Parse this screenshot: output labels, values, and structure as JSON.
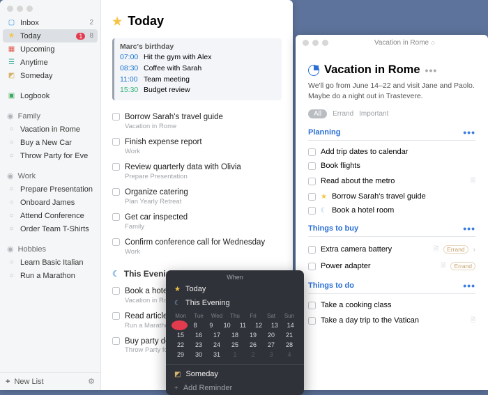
{
  "sidebar": {
    "inbox": {
      "label": "Inbox",
      "count": "2"
    },
    "today": {
      "label": "Today",
      "badge": "1",
      "count": "8"
    },
    "upcoming": {
      "label": "Upcoming"
    },
    "anytime": {
      "label": "Anytime"
    },
    "someday": {
      "label": "Someday"
    },
    "logbook": {
      "label": "Logbook"
    },
    "areas": [
      {
        "label": "Family",
        "items": [
          "Vacation in Rome",
          "Buy a New Car",
          "Throw Party for Eve"
        ]
      },
      {
        "label": "Work",
        "items": [
          "Prepare Presentation",
          "Onboard James",
          "Attend Conference",
          "Order Team T-Shirts"
        ]
      },
      {
        "label": "Hobbies",
        "items": [
          "Learn Basic Italian",
          "Run a Marathon"
        ]
      }
    ],
    "footer": {
      "new_list": "New List"
    }
  },
  "today": {
    "title": "Today",
    "schedule": {
      "heading": "Marc's birthday",
      "rows": [
        {
          "time": "07:00",
          "text": "Hit the gym with Alex"
        },
        {
          "time": "08:30",
          "text": "Coffee with Sarah"
        },
        {
          "time": "11:00",
          "text": "Team meeting"
        },
        {
          "time": "15:30",
          "text": "Budget review",
          "green": true
        }
      ]
    },
    "tasks": [
      {
        "title": "Borrow Sarah's travel guide",
        "sub": "Vacation in Rome"
      },
      {
        "title": "Finish expense report",
        "sub": "Work"
      },
      {
        "title": "Review quarterly data with Olivia",
        "sub": "Prepare Presentation"
      },
      {
        "title": "Organize catering",
        "sub": "Plan Yearly Retreat"
      },
      {
        "title": "Get car inspected",
        "sub": "Family"
      },
      {
        "title": "Confirm conference call for Wednesday",
        "sub": "Work"
      }
    ],
    "evening": {
      "title": "This Evening",
      "tasks": [
        {
          "title": "Book a hotel room",
          "sub": "Vacation in Rome"
        },
        {
          "title": "Read article about",
          "sub": "Run a Marathon"
        },
        {
          "title": "Buy party decoration",
          "sub": "Throw Party for Eve"
        }
      ]
    }
  },
  "popover": {
    "title": "When",
    "today": "Today",
    "evening": "This Evening",
    "days": [
      "Mon",
      "Tue",
      "Wed",
      "Thu",
      "Fri",
      "Sat",
      "Sun"
    ],
    "weeks": [
      [
        "",
        "",
        "8",
        "9",
        "10",
        "11",
        "12",
        "13",
        "14"
      ],
      [
        "",
        "15",
        "16",
        "17",
        "18",
        "19",
        "20",
        "21"
      ],
      [
        "",
        "22",
        "23",
        "24",
        "25",
        "26",
        "27",
        "28"
      ],
      [
        "",
        "29",
        "30",
        "31",
        "1",
        "2",
        "3",
        "4"
      ]
    ],
    "someday": "Someday",
    "reminder": "Add Reminder"
  },
  "project": {
    "window_title": "Vacation in Rome",
    "title": "Vacation in Rome",
    "note": "We'll go from June 14–22 and visit Jane and Paolo. Maybe do a night out in Trastevere.",
    "filters": {
      "all": "All",
      "errand": "Errand",
      "important": "Important"
    },
    "sections": [
      {
        "title": "Planning",
        "tasks": [
          {
            "title": "Add trip dates to calendar"
          },
          {
            "title": "Book flights"
          },
          {
            "title": "Read about the metro",
            "doc": true
          },
          {
            "title": "Borrow Sarah's travel guide",
            "star": true
          },
          {
            "title": "Book a hotel room",
            "moon": true
          }
        ]
      },
      {
        "title": "Things to buy",
        "tasks": [
          {
            "title": "Extra camera battery",
            "doc": true,
            "tag": "Errand",
            "chev": true
          },
          {
            "title": "Power adapter",
            "doc": true,
            "tag": "Errand"
          }
        ]
      },
      {
        "title": "Things to do",
        "tasks": [
          {
            "title": "Take a cooking class"
          },
          {
            "title": "Take a day trip to the Vatican",
            "doc": true
          }
        ]
      }
    ]
  }
}
